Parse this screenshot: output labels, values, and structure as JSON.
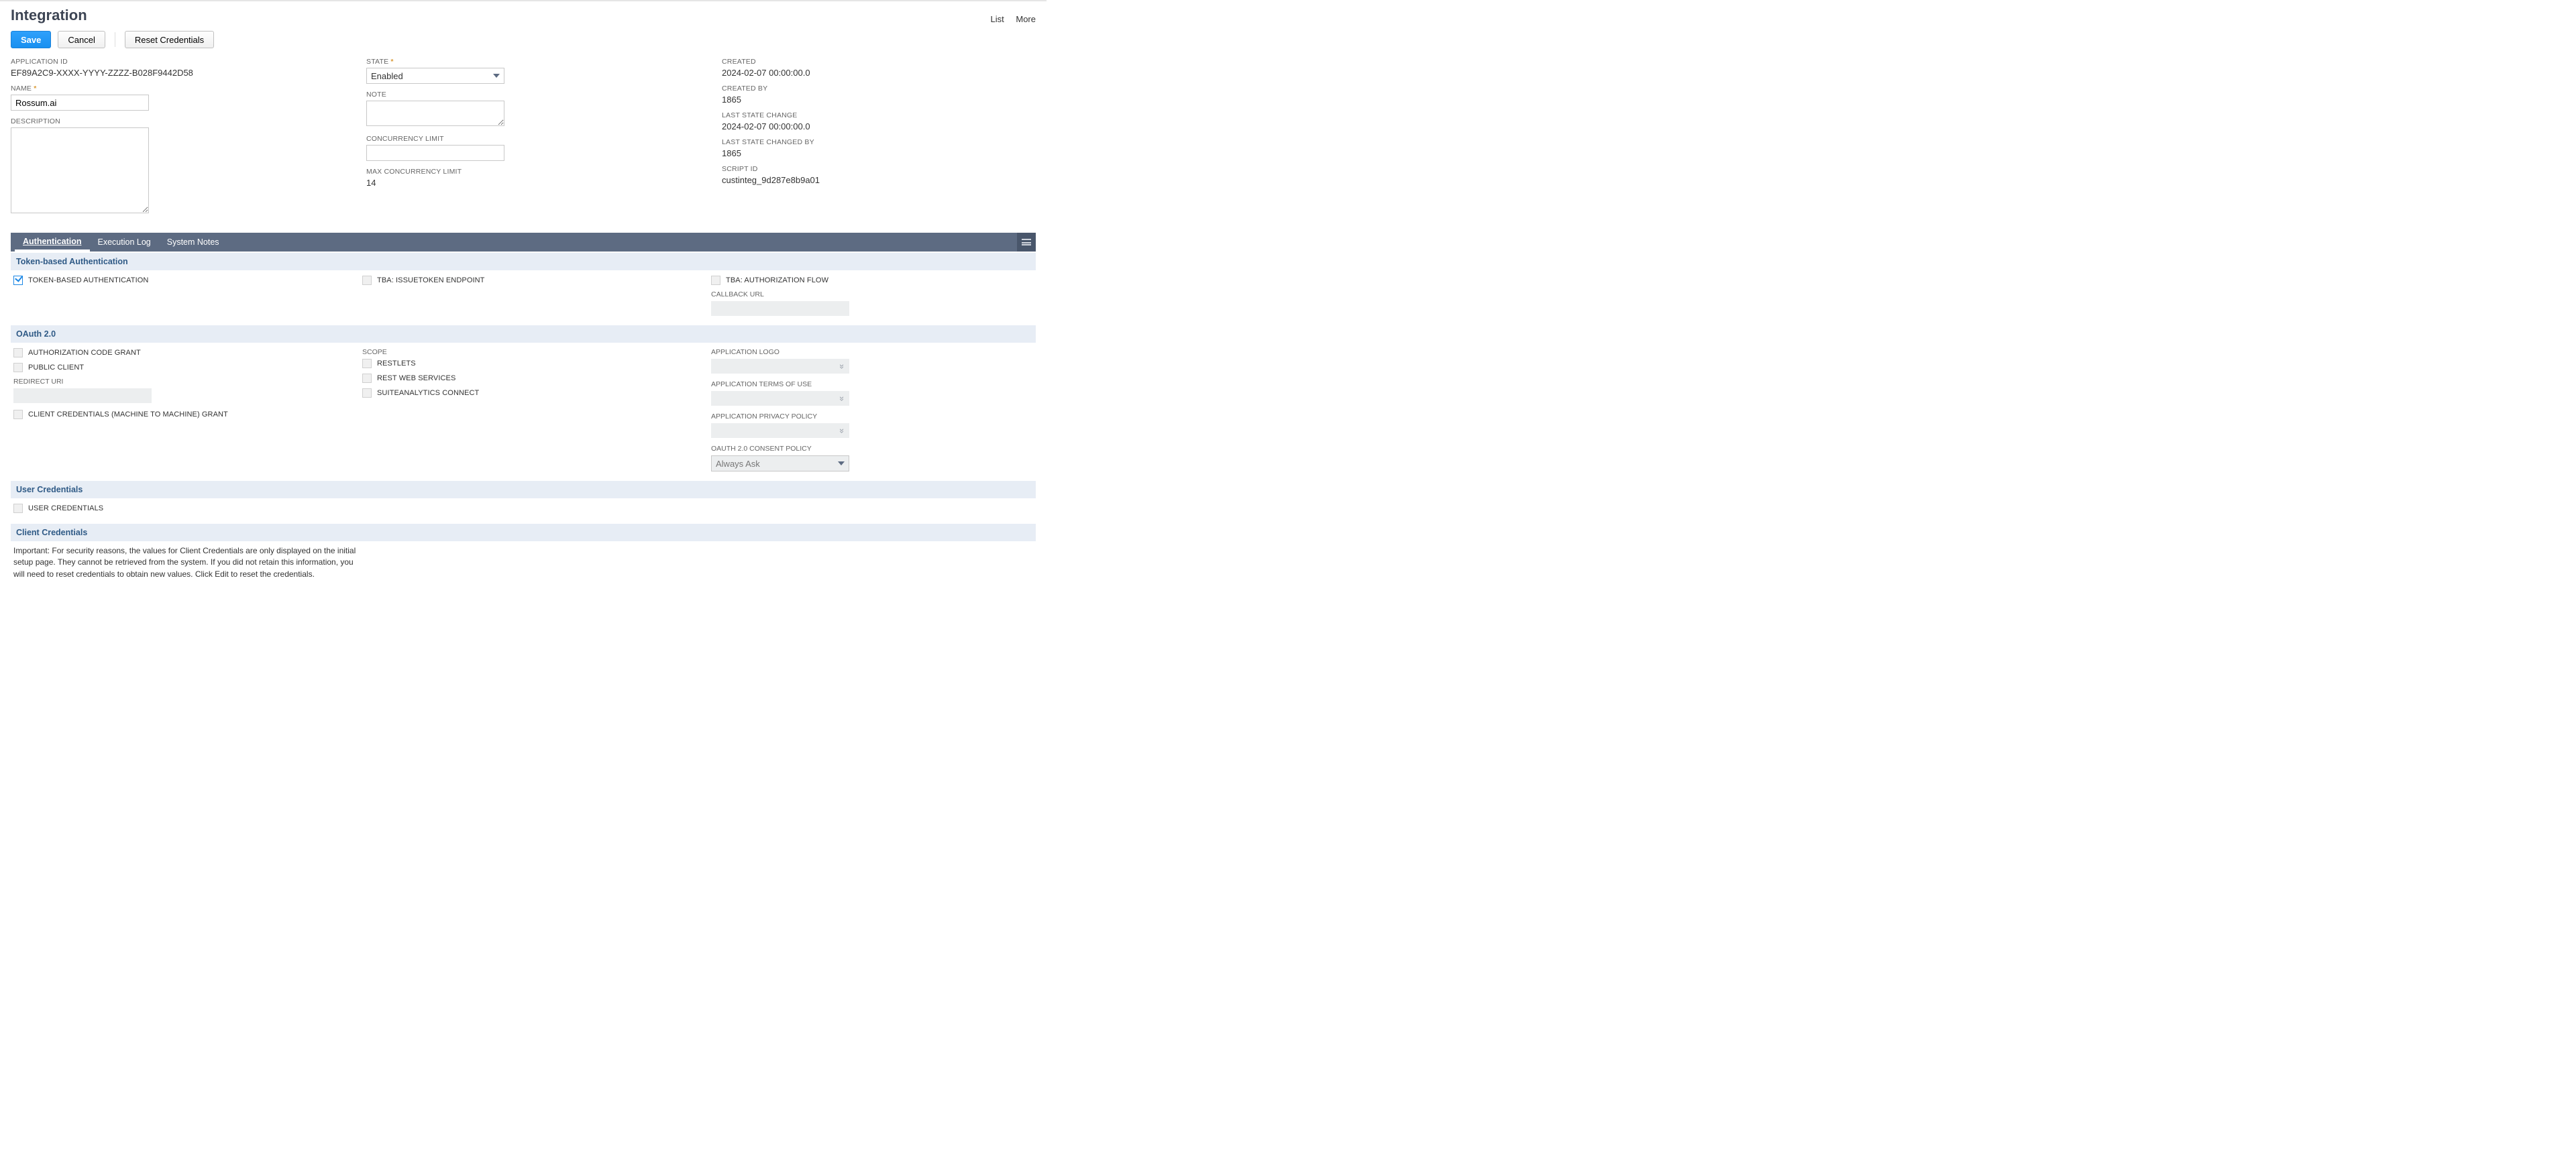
{
  "header": {
    "title": "Integration",
    "list": "List",
    "more": "More"
  },
  "buttons": {
    "save": "Save",
    "cancel": "Cancel",
    "reset_credentials": "Reset Credentials"
  },
  "fields": {
    "application_id": {
      "label": "APPLICATION ID",
      "value": "EF89A2C9-XXXX-YYYY-ZZZZ-B028F9442D58"
    },
    "name": {
      "label": "NAME",
      "value": "Rossum.ai"
    },
    "description": {
      "label": "DESCRIPTION",
      "value": ""
    },
    "state": {
      "label": "STATE",
      "value": "Enabled"
    },
    "note": {
      "label": "NOTE",
      "value": ""
    },
    "concurrency_limit": {
      "label": "CONCURRENCY LIMIT",
      "value": ""
    },
    "max_concurrency_limit": {
      "label": "MAX CONCURRENCY LIMIT",
      "value": "14"
    },
    "created": {
      "label": "CREATED",
      "value": "2024-02-07 00:00:00.0"
    },
    "created_by": {
      "label": "CREATED BY",
      "value": "1865"
    },
    "last_state_change": {
      "label": "LAST STATE CHANGE",
      "value": "2024-02-07 00:00:00.0"
    },
    "last_state_changed_by": {
      "label": "LAST STATE CHANGED BY",
      "value": "1865"
    },
    "script_id": {
      "label": "SCRIPT ID",
      "value": "custinteg_9d287e8b9a01"
    }
  },
  "tabs": {
    "authentication": "Authentication",
    "execution_log": "Execution Log",
    "system_notes": "System Notes"
  },
  "sections": {
    "tba": {
      "title": "Token-based Authentication",
      "token_based_auth": "TOKEN-BASED AUTHENTICATION",
      "issuetoken_endpoint": "TBA: ISSUETOKEN ENDPOINT",
      "authorization_flow": "TBA: AUTHORIZATION FLOW",
      "callback_url": "CALLBACK URL"
    },
    "oauth": {
      "title": "OAuth 2.0",
      "auth_code_grant": "AUTHORIZATION CODE GRANT",
      "public_client": "PUBLIC CLIENT",
      "redirect_uri": "REDIRECT URI",
      "client_credentials_grant": "CLIENT CREDENTIALS (MACHINE TO MACHINE) GRANT",
      "scope": "SCOPE",
      "restlets": "RESTLETS",
      "rest_web_services": "REST WEB SERVICES",
      "suiteanalytics": "SUITEANALYTICS CONNECT",
      "application_logo": "APPLICATION LOGO",
      "application_tos": "APPLICATION TERMS OF USE",
      "application_privacy": "APPLICATION PRIVACY POLICY",
      "consent_policy_label": "OAUTH 2.0 CONSENT POLICY",
      "consent_policy_value": "Always Ask"
    },
    "user_creds": {
      "title": "User Credentials",
      "user_credentials": "USER CREDENTIALS"
    },
    "client_creds": {
      "title": "Client Credentials",
      "note": "Important: For security reasons, the values for Client Credentials are only displayed on the initial setup page. They cannot be retrieved from the system. If you did not retain this information, you will need to reset credentials to obtain new values. Click Edit to reset the credentials."
    }
  }
}
